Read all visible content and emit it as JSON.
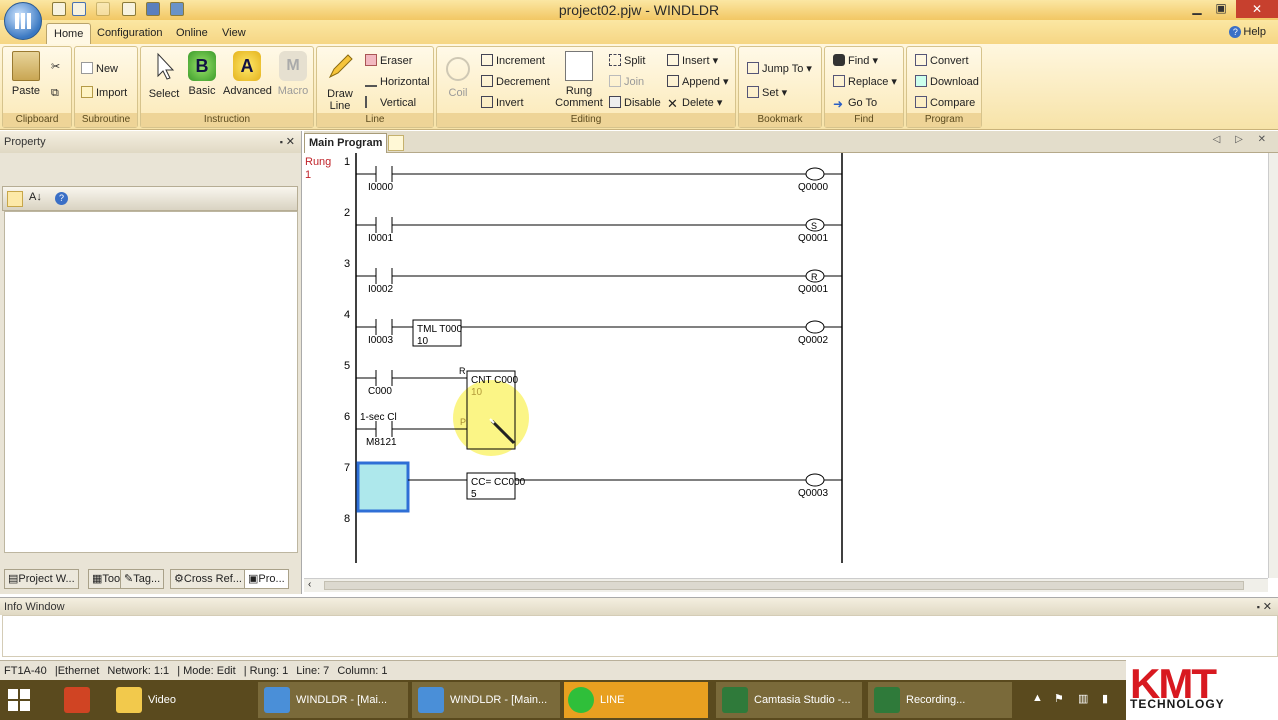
{
  "window": {
    "title": "project02.pjw - WINDLDR",
    "minimize": "▁",
    "restore": "▣",
    "close": "✕"
  },
  "ribbon_tabs": [
    "Home",
    "Configuration",
    "Online",
    "View"
  ],
  "help_label": "Help",
  "ribbon": {
    "clipboard": {
      "label": "Clipboard",
      "paste": "Paste"
    },
    "subroutine": {
      "label": "Subroutine",
      "new": "New",
      "import": "Import"
    },
    "instruction": {
      "label": "Instruction",
      "select": "Select",
      "basic": "Basic",
      "advanced": "Advanced",
      "macro": "Macro",
      "basic_glyph": "B",
      "advanced_glyph": "A",
      "macro_glyph": "M"
    },
    "line": {
      "label": "Line",
      "draw_line": "Draw Line",
      "eraser": "Eraser",
      "horizontal": "Horizontal",
      "vertical": "Vertical"
    },
    "editing": {
      "label": "Editing",
      "coil": "Coil",
      "increment": "Increment",
      "decrement": "Decrement",
      "invert": "Invert",
      "rung_comment": "Rung Comment",
      "split": "Split",
      "join": "Join",
      "disable": "Disable",
      "insert": "Insert",
      "append": "Append",
      "delete": "Delete"
    },
    "bookmark": {
      "label": "Bookmark",
      "jump_to": "Jump To",
      "set": "Set"
    },
    "find": {
      "label": "Find",
      "find": "Find",
      "replace": "Replace",
      "go_to": "Go To"
    },
    "program": {
      "label": "Program",
      "convert": "Convert",
      "download": "Download",
      "compare": "Compare"
    }
  },
  "property_panel": {
    "title": "Property",
    "pin": "📌",
    "close": "✕"
  },
  "panel_tabs": [
    "Project W...",
    "Too...",
    "Tag...",
    "Cross Ref...",
    "Pro..."
  ],
  "editor": {
    "tab": "Main Program",
    "arrows": "◁ ▷ ✕"
  },
  "ladder": {
    "rung_header": "Rung",
    "rung_header_sub": "1",
    "rungs": [
      {
        "num": "1",
        "contact": "I0000",
        "coil": "Q0000",
        "coil_mark": ""
      },
      {
        "num": "2",
        "contact": "I0001",
        "coil": "Q0001",
        "coil_mark": "S"
      },
      {
        "num": "3",
        "contact": "I0002",
        "coil": "Q0001",
        "coil_mark": "R"
      },
      {
        "num": "4",
        "contact": "I0003",
        "coil": "Q0002",
        "coil_mark": "",
        "box_title": "TML T000",
        "box_value": "10"
      },
      {
        "num": "5",
        "contact": "C000",
        "box_title": "CNT C000",
        "box_value": "10",
        "reset_label": "R",
        "pulse_label": "P"
      },
      {
        "num": "6",
        "contact": "M8121",
        "comment": "1-sec Cl"
      },
      {
        "num": "7",
        "coil": "Q0003",
        "coil_mark": "",
        "box_title": "CC= CC000",
        "box_value": "5"
      },
      {
        "num": "8"
      }
    ]
  },
  "info_window": {
    "title": "Info Window"
  },
  "status_bar": [
    "FT1A-40",
    "|Ethernet",
    "Network: 1:1",
    "| Mode: Edit",
    "| Rung: 1",
    "Line: 7",
    "Column: 1"
  ],
  "taskbar": [
    {
      "label": "",
      "icon": "powerpoint-icon"
    },
    {
      "label": "Video",
      "icon": "folder-icon"
    },
    {
      "label": "WINDLDR - [Mai...",
      "icon": "windldr-icon"
    },
    {
      "label": "WINDLDR - [Main...",
      "icon": "windldr-icon"
    },
    {
      "label": "LINE",
      "icon": "line-icon"
    },
    {
      "label": "Camtasia Studio -...",
      "icon": "camtasia-icon"
    },
    {
      "label": "Recording...",
      "icon": "camtasia-icon"
    }
  ],
  "brand": {
    "name": "KMT",
    "tagline": "TECHNOLOGY"
  },
  "colors": {
    "accent": "#f2c764",
    "selection": "#aee8ec",
    "selection_border": "#2f6fd6",
    "highlight": "#f9f25e"
  }
}
